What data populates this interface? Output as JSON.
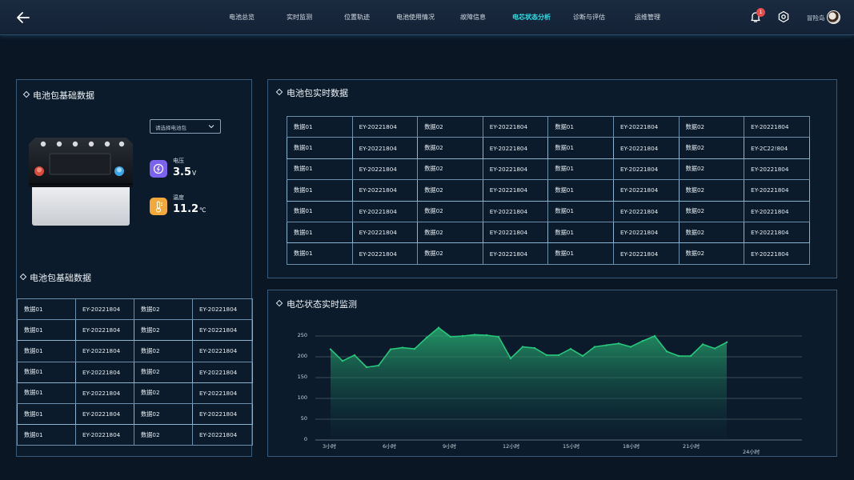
{
  "header": {
    "nav": [
      {
        "label": "电池总览",
        "active": false
      },
      {
        "label": "实时监测",
        "active": false
      },
      {
        "label": "位置轨迹",
        "active": false
      },
      {
        "label": "电池使用情况",
        "active": false
      },
      {
        "label": "故障信息",
        "active": false
      },
      {
        "label": "电芯状态分析",
        "active": true
      },
      {
        "label": "诊断与评估",
        "active": false
      },
      {
        "label": "运维管理",
        "active": false
      }
    ],
    "notification_count": "1",
    "username": "冒险岛"
  },
  "basic_panel": {
    "title": "电池包基础数据",
    "select_placeholder": "请选择电池包",
    "voltage_label": "电压",
    "voltage_value": "3.5",
    "voltage_unit": "V",
    "temperature_label": "温度",
    "temperature_value": "11.2",
    "temperature_unit": "℃",
    "voltage_icon_color": "#7b63f0",
    "temperature_icon_color": "#f3a93a"
  },
  "basic_table": {
    "title": "电池包基础数据",
    "rows": [
      [
        "数据01",
        "EY-20221804",
        "数据02",
        "EY-20221804"
      ],
      [
        "数据01",
        "EY-20221804",
        "数据02",
        "EY-20221804"
      ],
      [
        "数据01",
        "EY-20221804",
        "数据02",
        "EY-20221804"
      ],
      [
        "数据01",
        "EY-20221804",
        "数据02",
        "EY-20221804"
      ],
      [
        "数据01",
        "EY-20221804",
        "数据02",
        "EY-20221804"
      ],
      [
        "数据01",
        "EY-20221804",
        "数据02",
        "EY-20221804"
      ],
      [
        "数据01",
        "EY-20221804",
        "数据02",
        "EY-20221804"
      ]
    ]
  },
  "realtime_panel": {
    "title": "电池包实时数据",
    "rows": [
      [
        "数据01",
        "EY-20221804",
        "数据02",
        "EY-20221804",
        "数据01",
        "EY-20221804",
        "数据02",
        "EY-20221804"
      ],
      [
        "数据01",
        "EY-20221804",
        "数据02",
        "EY-20221804",
        "数据01",
        "EY-20221804",
        "数据02",
        "EY-2C22!804"
      ],
      [
        "数据01",
        "EY-20221804",
        "数据02",
        "EY-20221804",
        "数据01",
        "EY-20221804",
        "数据02",
        "EY-20221804"
      ],
      [
        "数据01",
        "EY-20221804",
        "数据02",
        "EY-20221804",
        "数据01",
        "EY-20221804",
        "数据02",
        "EY-20221804"
      ],
      [
        "数据01",
        "EY-20221804",
        "数据02",
        "EY-20221804",
        "数据01",
        "EY-20221804",
        "数据02",
        "EY-20221804"
      ],
      [
        "数据01",
        "EY-20221804",
        "数据02",
        "EY-20221804",
        "数据01",
        "EY-20221804",
        "数据02",
        "EY-20221804"
      ],
      [
        "数据01",
        "EY-20221804",
        "数据02",
        "EY-20221804",
        "数据01",
        "EY-20221804",
        "数据02",
        "EY-20221804"
      ]
    ]
  },
  "monitor_panel": {
    "title": "电芯状态实时监测"
  },
  "chart_data": {
    "type": "area",
    "title": "",
    "xlabel": "",
    "ylabel": "",
    "ylim": [
      0,
      250
    ],
    "yticks": [
      0,
      50,
      100,
      150,
      200,
      250
    ],
    "x_tick_labels": [
      {
        "label": "3小时",
        "at": 0
      },
      {
        "label": "6小时",
        "at": 5
      },
      {
        "label": "9小时",
        "at": 10
      },
      {
        "label": "12小时",
        "at": 15
      },
      {
        "label": "15小时",
        "at": 20
      },
      {
        "label": "18小时",
        "at": 25
      },
      {
        "label": "21小时",
        "at": 30
      },
      {
        "label": "24小时",
        "at": 35
      }
    ],
    "grid": true,
    "line_color": "#27c77c",
    "series": [
      {
        "values": [
          218,
          190,
          204,
          175,
          179,
          218,
          222,
          219,
          246,
          270,
          248,
          250,
          253,
          252,
          248,
          196,
          224,
          221,
          204,
          204,
          219,
          202,
          224,
          228,
          232,
          224,
          238,
          250,
          213,
          202,
          202,
          230,
          220,
          235
        ]
      }
    ]
  }
}
